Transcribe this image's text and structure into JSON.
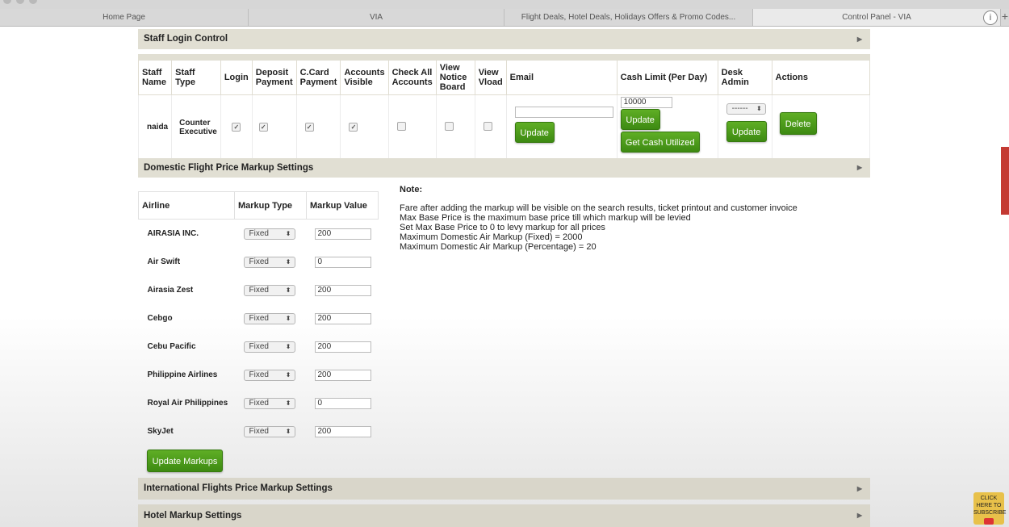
{
  "browser": {
    "tabs": [
      "Home Page",
      "VIA",
      "Flight Deals, Hotel Deals, Holidays Offers & Promo Codes...",
      "Control Panel - VIA"
    ],
    "info_icon": "i",
    "new_tab_icon": "+"
  },
  "staff_section": {
    "title": "Staff Login Control",
    "headers": [
      "Staff Name",
      "Staff Type",
      "Login",
      "Deposit Payment",
      "C.Card Payment",
      "Accounts Visible",
      "Check All Accounts",
      "View Notice Board",
      "View Vload",
      "Email",
      "Cash Limit (Per Day)",
      "Desk Admin",
      "Actions"
    ],
    "row": {
      "name": "naida",
      "type": "Counter Executive",
      "login": true,
      "deposit_payment": true,
      "ccard_payment": true,
      "accounts_visible": true,
      "check_all_accounts": false,
      "view_notice_board": false,
      "view_vload": false,
      "email": "",
      "email_button": "Update",
      "cash_limit": "10000",
      "cash_update_button": "Update",
      "cash_utilized_button": "Get Cash Utilized",
      "desk_admin_value": "------",
      "desk_update_button": "Update",
      "delete_button": "Delete"
    }
  },
  "domestic_section": {
    "title": "Domestic Flight Price Markup Settings",
    "headers": [
      "Airline",
      "Markup Type",
      "Markup Value"
    ],
    "rows": [
      {
        "airline": "AIRASIA INC.",
        "type": "Fixed",
        "value": "200"
      },
      {
        "airline": "Air Swift",
        "type": "Fixed",
        "value": "0"
      },
      {
        "airline": "Airasia Zest",
        "type": "Fixed",
        "value": "200"
      },
      {
        "airline": "Cebgo",
        "type": "Fixed",
        "value": "200"
      },
      {
        "airline": "Cebu Pacific",
        "type": "Fixed",
        "value": "200"
      },
      {
        "airline": "Philippine Airlines",
        "type": "Fixed",
        "value": "200"
      },
      {
        "airline": "Royal Air Philippines",
        "type": "Fixed",
        "value": "0"
      },
      {
        "airline": "SkyJet",
        "type": "Fixed",
        "value": "200"
      }
    ],
    "update_button": "Update Markups",
    "note_title": "Note:",
    "notes": [
      "Fare after adding the markup will be visible on the search results, ticket printout and customer invoice",
      "Max Base Price is the maximum base price till which markup will be levied",
      "Set Max Base Price to 0 to levy markup for all prices",
      "Maximum Domestic Air Markup (Fixed) = 2000",
      "Maximum Domestic Air Markup (Percentage) = 20"
    ]
  },
  "international_section": {
    "title": "International Flights Price Markup Settings"
  },
  "hotel_section": {
    "title": "Hotel Markup Settings"
  },
  "subscribe_badge": "CLICK HERE TO SUBSCRIBE"
}
